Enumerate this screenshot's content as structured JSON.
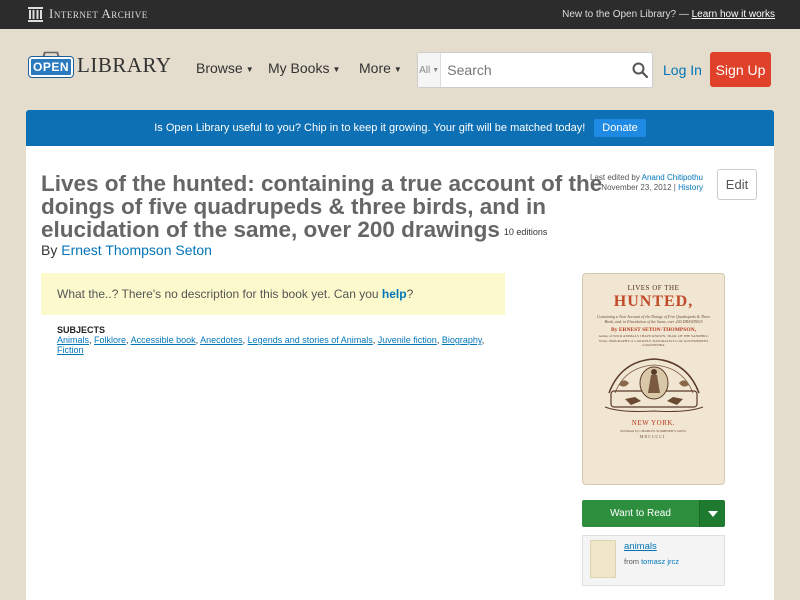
{
  "ia_bar": {
    "logo_text": "Internet Archive",
    "new_text": "New to the Open Library? —",
    "learn_link": "Learn how it works"
  },
  "header": {
    "logo_badge": "OPEN",
    "logo_word": "LIBRARY",
    "nav": [
      {
        "label": "Browse"
      },
      {
        "label": "My Books"
      },
      {
        "label": "More"
      }
    ],
    "search": {
      "scope": "All",
      "placeholder": "Search"
    },
    "login_label": "Log In",
    "signup_label": "Sign Up"
  },
  "banner": {
    "text": "Is Open Library useful to you? Chip in to keep it growing. Your gift will be matched today!",
    "donate_label": "Donate"
  },
  "book": {
    "title": "Lives of the hunted: containing a true account of the doings of five quadrupeds & three birds, and in elucidation of the same, over 200 drawings",
    "editions": "10 editions",
    "by_label": "By",
    "author": "Ernest Thompson Seton",
    "edited_prefix": "Last edited by",
    "edited_by": "Anand Chitipothu",
    "edited_date": "November 23, 2012",
    "edited_sep": "|",
    "history_label": "History",
    "edit_label": "Edit",
    "description_prefix": "What the..? There's no description for this book yet. Can you",
    "description_link": "help",
    "description_suffix": "?",
    "subjects_header": "SUBJECTS",
    "subjects": [
      "Animals",
      "Folklore",
      "Accessible book",
      "Anecdotes",
      "Legends and stories of Animals",
      "Juvenile fiction",
      "Biography",
      "Fiction"
    ]
  },
  "cover": {
    "line1": "LIVES OF THE",
    "line2": "HUNTED,",
    "small1": "Containing a True Account of the Doings of Five Quadrupeds & Three Birds, and, in Elucidation of the Same, over 200 DRAWINGS",
    "author": "By ERNEST SETON-THOMPSON,",
    "small2": "Author of WILD ANIMALS I HAVE KNOWN, TRAIL OF THE SANDHILL STAG, BIOGRAPHY of a GRIZZLY, NATURALIST to the GOVERNMENT of MANITOBA.",
    "place": "NEW YORK.",
    "publisher": "Published by CHARLES SCRIBNER'S SONS.",
    "year": "MDCCCCI."
  },
  "sidebar": {
    "want_to_read": "Want to Read",
    "list_name": "animals",
    "list_from_prefix": "from",
    "list_from_user": "tomasz jrcz"
  },
  "colors": {
    "ia_bar": "#2c2c2c",
    "page_bg": "#e4dccc",
    "banner": "#0d6fb4",
    "signup": "#e0412a",
    "want_to_read": "#2d8f3e",
    "link": "#0376b8"
  }
}
